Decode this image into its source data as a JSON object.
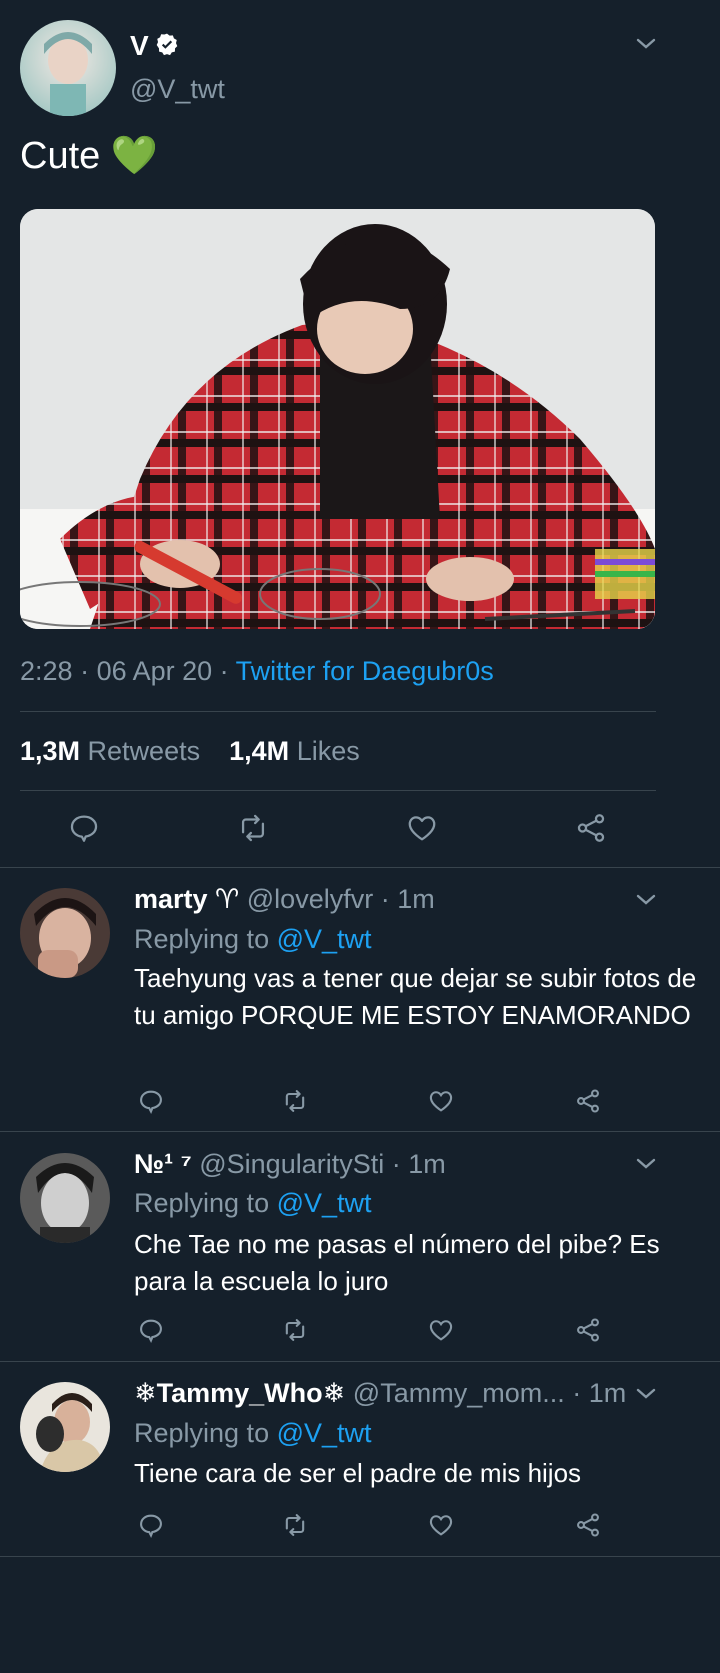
{
  "tweet": {
    "display_name": "V",
    "handle": "@V_twt",
    "text": "Cute",
    "emoji": "💚",
    "time": "2:28",
    "date": "06 Apr 20",
    "source": "Twitter for Daegubr0s",
    "separator": " · ",
    "retweets_count": "1,3M",
    "retweets_label": "Retweets",
    "likes_count": "1,4M",
    "likes_label": "Likes",
    "colors": {
      "background": "#15202b",
      "accent": "#1da1f2",
      "muted": "#8899a6",
      "divider": "#38444d"
    }
  },
  "replies": [
    {
      "name": "marty ♈",
      "handle": "@lovelyfvr",
      "time": "1m",
      "replying_label": "Replying to",
      "replying_to": "@V_twt",
      "text": "Taehyung vas a tener que dejar se subir fotos de tu amigo PORQUE ME ESTOY ENAMORANDO"
    },
    {
      "name": "№¹ ⁷",
      "handle": "@SingularitySti",
      "time": "1m",
      "replying_label": "Replying to",
      "replying_to": "@V_twt",
      "text": "Che Tae no me pasas el número del pibe? Es para la escuela lo juro"
    },
    {
      "name": "❄Tammy_Who❄",
      "handle": "@Tammy_mom...",
      "time": "1m",
      "replying_label": "Replying to",
      "replying_to": "@V_twt",
      "text": "Tiene cara de ser el padre de mis hijos"
    }
  ],
  "icons": {
    "verified": "verified-badge-icon",
    "chevron": "chevron-down-icon",
    "reply": "reply-icon",
    "retweet": "retweet-icon",
    "like": "heart-icon",
    "share": "share-icon"
  }
}
